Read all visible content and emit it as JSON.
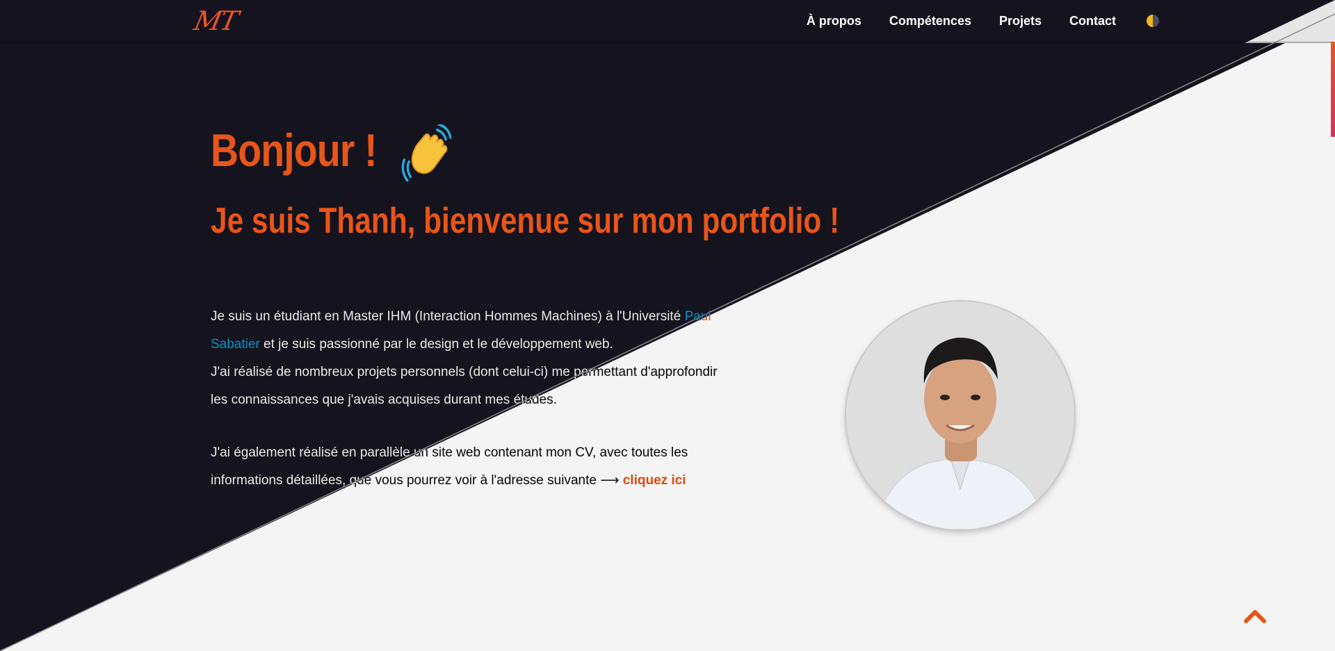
{
  "nav": {
    "logo": "MT",
    "links": [
      "À propos",
      "Compétences",
      "Projets",
      "Contact"
    ],
    "theme_toggle_icon": "half-moon-icon"
  },
  "hero": {
    "greeting": "Bonjour !",
    "greeting_icon": "waving-hand-icon",
    "headline": "Je suis Thanh, bienvenue sur mon portfolio !",
    "intro": {
      "p1_before": "Je suis un étudiant en Master IHM (Interaction Hommes Machines) à l'Université ",
      "p1_link": "Paul Sabatier",
      "p1_after": " et je suis passionné par le design et le développement web.",
      "p2": "J'ai réalisé de nombreux projets personnels (dont celui-ci) me permettant d'approfondir les connaissances que j'avais acquises durant mes études.",
      "p3_before": "J'ai également réalisé en parallèle un site web contenant mon CV, avec toutes les informations détaillées, que vous pourrez voir à l'adresse suivante ⟶ ",
      "p3_link": "cliquez ici"
    },
    "avatar_icon": "profile-photo"
  },
  "scroll_top_icon": "chevron-up-icon",
  "colors": {
    "accent": "#e8551a",
    "dark_bg": "#15131e",
    "light_bg": "#f4f4f4"
  }
}
